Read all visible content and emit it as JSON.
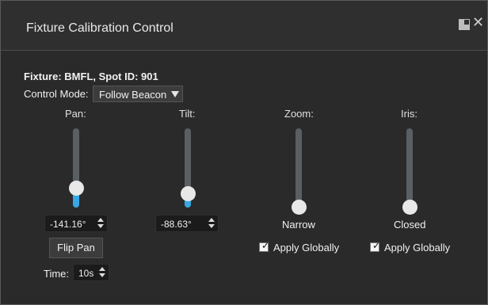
{
  "window": {
    "title": "Fixture Calibration Control"
  },
  "header": {
    "fixture_info": "Fixture: BMFL, Spot ID: 901",
    "control_mode_label": "Control Mode:",
    "control_mode_value": "Follow Beacon"
  },
  "pan": {
    "label": "Pan:",
    "value": "-141.16°",
    "slider_fraction": 0.25,
    "flip_button": "Flip Pan",
    "time_label": "Time:",
    "time_value": "10s"
  },
  "tilt": {
    "label": "Tilt:",
    "value": "-88.63°",
    "slider_fraction": 0.17
  },
  "zoom": {
    "label": "Zoom:",
    "value": "Narrow",
    "slider_fraction": 0,
    "apply_globally_label": "Apply Globally",
    "apply_globally_checked": true
  },
  "iris": {
    "label": "Iris:",
    "value": "Closed",
    "slider_fraction": 0,
    "apply_globally_label": "Apply Globally",
    "apply_globally_checked": true
  },
  "colors": {
    "background": "#2a2a2a",
    "accent": "#38a7e6",
    "text": "#f0f0f0"
  }
}
